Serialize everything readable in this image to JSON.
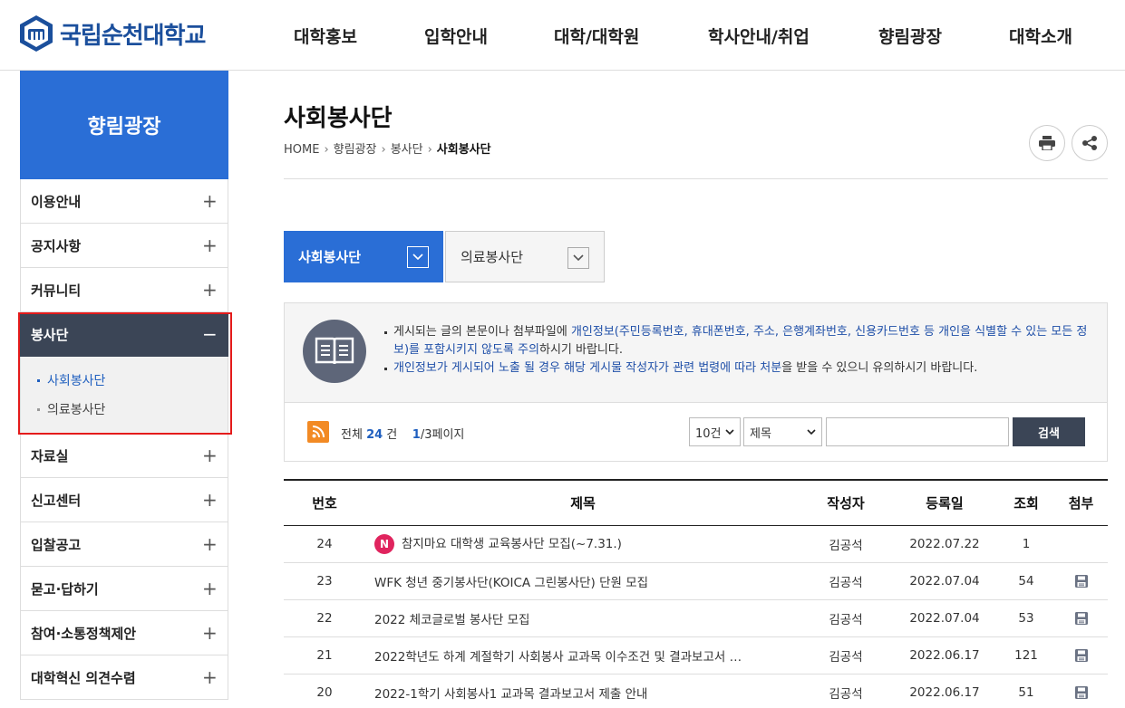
{
  "header": {
    "logo_text": "국립순천대학교",
    "nav": [
      "대학홍보",
      "입학안내",
      "대학/대학원",
      "학사안내/취업",
      "향림광장",
      "대학소개"
    ]
  },
  "sidebar": {
    "title": "향림광장",
    "items": [
      {
        "label": "이용안내",
        "sign": "+"
      },
      {
        "label": "공지사항",
        "sign": "+"
      },
      {
        "label": "커뮤니티",
        "sign": "+"
      },
      {
        "label": "봉사단",
        "sign": "−"
      },
      {
        "label": "자료실",
        "sign": "+"
      },
      {
        "label": "신고센터",
        "sign": "+"
      },
      {
        "label": "입찰공고",
        "sign": "+"
      },
      {
        "label": "묻고·답하기",
        "sign": "+"
      },
      {
        "label": "참여·소통정책제안",
        "sign": "+"
      },
      {
        "label": "대학혁신 의견수렴",
        "sign": "+"
      }
    ],
    "sub_items": [
      "사회봉사단",
      "의료봉사단"
    ]
  },
  "page": {
    "title": "사회봉사단",
    "breadcrumb": [
      "HOME",
      "향림광장",
      "봉사단",
      "사회봉사단"
    ]
  },
  "tabs": {
    "active": "사회봉사단",
    "inactive": "의료봉사단"
  },
  "notice": {
    "line1_pre": "게시되는 글의 본문이나 첨부파일에 ",
    "line1_blue": "개인정보(주민등록번호, 휴대폰번호, 주소, 은행계좌번호, 신용카드번호 등 개인을 식별할 수 있는 모든 정보)를 포함시키지 않도록 주의",
    "line1_post": "하시기 바랍니다.",
    "line2_blue": "개인정보가 게시되어 노출 될 경우 해당 게시물 작성자가 관련 법령에 따라 처분",
    "line2_post": "을 받을 수 있으니 유의하시기 바랍니다."
  },
  "board_top": {
    "total_prefix": "전체",
    "total_count": "24",
    "total_unit": "건",
    "page_current": "1",
    "page_rest": "/3페이지",
    "per_page": "10건",
    "search_field": "제목",
    "search_value": "",
    "search_button": "검색"
  },
  "table": {
    "columns": [
      "번호",
      "제목",
      "작성자",
      "등록일",
      "조회",
      "첨부"
    ],
    "rows": [
      {
        "no": "24",
        "badge": "N",
        "title": "참지마요 대학생 교육봉사단 모집(~7.31.)",
        "author": "김공석",
        "date": "2022.07.22",
        "views": "1",
        "attach": false
      },
      {
        "no": "23",
        "badge": "",
        "title": "WFK 청년 중기봉사단(KOICA 그린봉사단) 단원 모집",
        "author": "김공석",
        "date": "2022.07.04",
        "views": "54",
        "attach": true
      },
      {
        "no": "22",
        "badge": "",
        "title": "2022 체코글로벌 봉사단 모집",
        "author": "김공석",
        "date": "2022.07.04",
        "views": "53",
        "attach": true
      },
      {
        "no": "21",
        "badge": "",
        "title": "2022학년도 하계 계절학기 사회봉사 교과목 이수조건 및 결과보고서 …",
        "author": "김공석",
        "date": "2022.06.17",
        "views": "121",
        "attach": true
      },
      {
        "no": "20",
        "badge": "",
        "title": "2022-1학기 사회봉사1 교과목 결과보고서 제출 안내",
        "author": "김공석",
        "date": "2022.06.17",
        "views": "51",
        "attach": true
      }
    ]
  },
  "colors": {
    "brand_blue": "#2a6ed6",
    "dark_nav": "#3b4556",
    "highlight_red": "#e41b1b",
    "new_badge": "#e0245e",
    "rss_orange": "#f28a24"
  },
  "icons": [
    "university-logo-icon",
    "print-icon",
    "share-icon",
    "book-icon",
    "rss-icon",
    "file-icon",
    "chevron-down-icon"
  ]
}
